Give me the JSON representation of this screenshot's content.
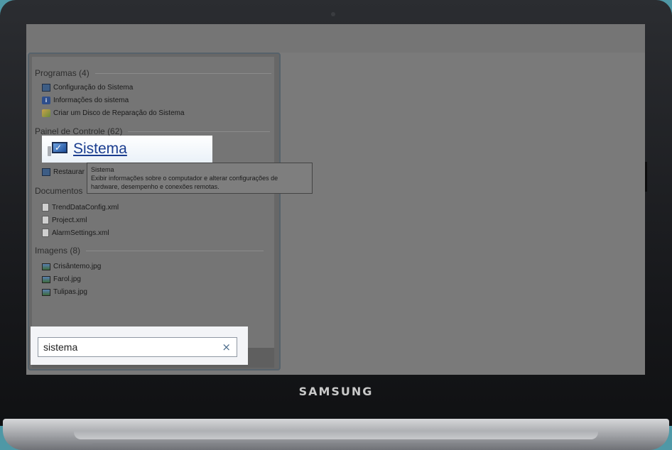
{
  "device": {
    "brand": "SAMSUNG"
  },
  "start_menu": {
    "groups": [
      {
        "header": "Programas (4)",
        "items": [
          {
            "label": "Configuração do Sistema",
            "icon": "system-config-icon"
          },
          {
            "label": "Informações do sistema",
            "icon": "system-info-icon"
          },
          {
            "label": "Criar um Disco de Reparação do Sistema",
            "icon": "repair-disc-icon"
          }
        ]
      },
      {
        "header": "Painel de Controle (62)",
        "items": [
          {
            "label": "Restaurar",
            "icon": "restore-icon"
          }
        ]
      },
      {
        "header": "Documentos",
        "items": [
          {
            "label": "TrendDataConfig.xml",
            "icon": "document-icon"
          },
          {
            "label": "Project.xml",
            "icon": "document-icon"
          },
          {
            "label": "AlarmSettings.xml",
            "icon": "document-icon"
          }
        ]
      },
      {
        "header": "Imagens (8)",
        "items": [
          {
            "label": "Crisântemo.jpg",
            "icon": "image-icon"
          },
          {
            "label": "Farol.jpg",
            "icon": "image-icon"
          },
          {
            "label": "Tulipas.jpg",
            "icon": "image-icon"
          }
        ]
      }
    ],
    "highlighted_result": {
      "label": "Sistema",
      "icon": "system-icon"
    },
    "tooltip": {
      "title": "Sistema",
      "line1": "Exibir informações sobre o computador e alterar configurações de",
      "line2": "hardware, desempenho e conexões remotas."
    },
    "search": {
      "value": "sistema",
      "clear_glyph": "×"
    }
  },
  "colors": {
    "link": "#1a3d8f",
    "dim_overlay": "#7a7a7a",
    "background_teal": "#4f98a6"
  }
}
